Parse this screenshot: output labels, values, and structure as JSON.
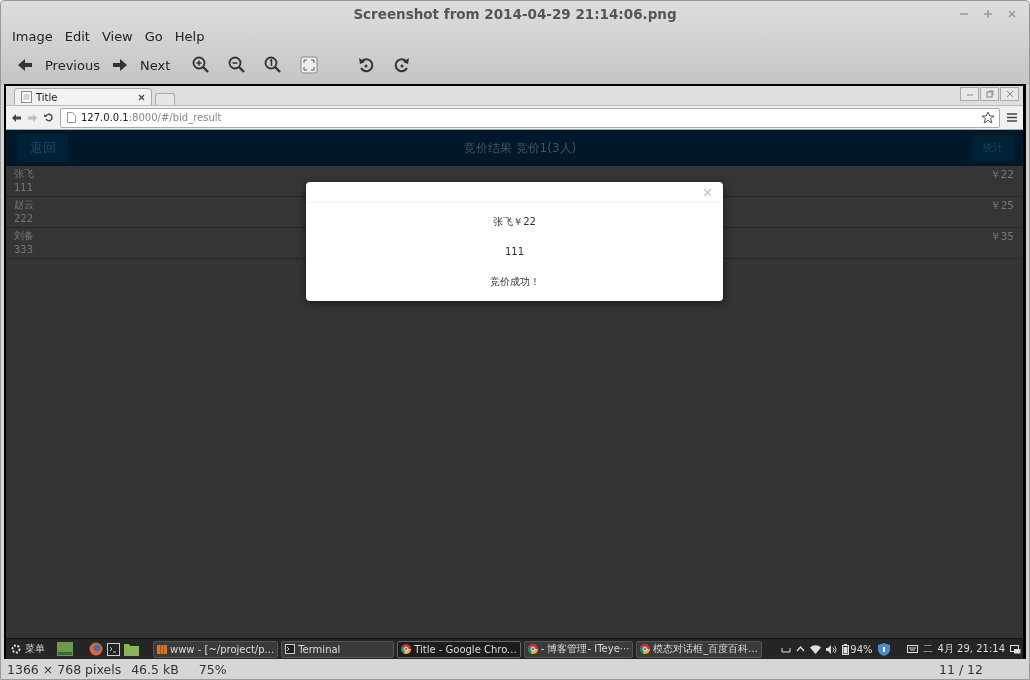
{
  "window": {
    "title": "Screenshot from 2014-04-29 21:14:06.png"
  },
  "menu": [
    "Image",
    "Edit",
    "View",
    "Go",
    "Help"
  ],
  "toolbar": [
    {
      "kind": "previous",
      "label": "Previous"
    },
    {
      "kind": "next",
      "label": "Next"
    },
    {
      "kind": "zoom-in"
    },
    {
      "kind": "zoom-out"
    },
    {
      "kind": "zoom-normal"
    },
    {
      "kind": "fit"
    },
    {
      "kind": "rotate-left"
    },
    {
      "kind": "rotate-right"
    }
  ],
  "browser": {
    "tabs": [
      {
        "label": "Title",
        "selected": true
      }
    ],
    "address": {
      "host": "127.0.0.1",
      "path": ":8000/#/bid_result"
    },
    "page": {
      "back_button": "返回",
      "title": "竞价结果 竞价1(3人)",
      "stats_button": "统计",
      "rows": [
        {
          "name": "张飞",
          "code": "111",
          "price": "￥22"
        },
        {
          "name": "赵云",
          "code": "222",
          "price": "￥25"
        },
        {
          "name": "刘备",
          "code": "333",
          "price": "￥35"
        }
      ],
      "modal": {
        "lines": [
          "张飞￥22",
          "111",
          "竞价成功！"
        ]
      }
    }
  },
  "taskbar": {
    "start_label": "菜单",
    "tasks": [
      {
        "label": "www - [~/project/p...",
        "selected": false
      },
      {
        "label": "Terminal",
        "selected": false
      },
      {
        "label": "Title - Google Chro...",
        "selected": true
      },
      {
        "label": "- 博客管理- ITeye···",
        "selected": false
      },
      {
        "label": "模态对话框_百度百科...",
        "selected": false
      }
    ],
    "battery": "94%",
    "weekday": "二",
    "clock": "4月 29, 21:14"
  },
  "status_bar": {
    "dimensions": "1366 × 768 pixels",
    "file_size": "46.5 kB",
    "zoom": "75%",
    "position": "11 / 12"
  }
}
